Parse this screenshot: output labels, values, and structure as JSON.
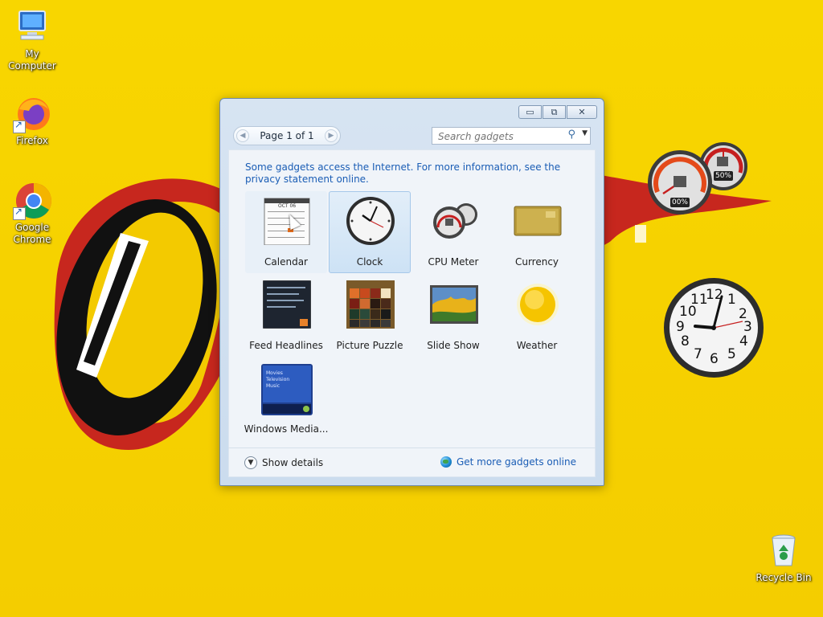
{
  "desktop": {
    "icons": [
      {
        "label": "My Computer"
      },
      {
        "label": "Firefox"
      },
      {
        "label": "Google Chrome"
      },
      {
        "label": "Recycle Bin"
      }
    ],
    "cpu_widget": {
      "cpu": "00%",
      "memory": "50%"
    },
    "clock_widget": {
      "numbers": [
        "12",
        "1",
        "2",
        "3",
        "4",
        "5",
        "6",
        "7",
        "8",
        "9",
        "10",
        "11"
      ]
    }
  },
  "gallery": {
    "pager": {
      "text": "Page 1 of 1"
    },
    "search": {
      "placeholder": "Search gadgets"
    },
    "info_text": "Some gadgets access the Internet.  For more information, see the privacy statement online.",
    "gadgets": [
      {
        "label": "Calendar"
      },
      {
        "label": "Clock"
      },
      {
        "label": "CPU Meter"
      },
      {
        "label": "Currency"
      },
      {
        "label": "Feed Headlines"
      },
      {
        "label": "Picture Puzzle"
      },
      {
        "label": "Slide Show"
      },
      {
        "label": "Weather"
      },
      {
        "label": "Windows Media..."
      }
    ],
    "calendar_thumb": {
      "month": "OCT 06"
    },
    "media_thumb": {
      "lines": [
        "Movies",
        "Television",
        "Music"
      ]
    },
    "footer": {
      "show_details": "Show details",
      "get_more": "Get more gadgets online"
    }
  },
  "colors": {
    "accent": "#1a5db5",
    "wallpaper": "#f6d400"
  }
}
